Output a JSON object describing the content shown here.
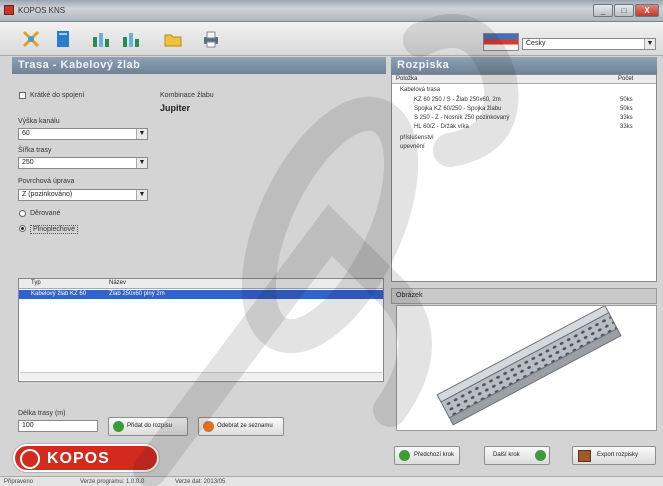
{
  "window": {
    "title": "KOPOS KNS",
    "minimize": "_",
    "maximize": "□",
    "close": "X"
  },
  "toolbar": {
    "tools": [
      "new-icon",
      "book-icon",
      "bar-chart-icon",
      "bar-chart-icon",
      "folder-icon",
      "printer-icon"
    ],
    "language": {
      "value": "Česky",
      "arrow": "▼"
    }
  },
  "left": {
    "section_title": "Trasa - Kabelový žlab",
    "chk_label": "Krátké do spojení",
    "product_caption": "Kombinace žlabu",
    "product_name": "Jupiter",
    "fields": [
      {
        "label": "Výška kanálu",
        "value": "60"
      },
      {
        "label": "Šířka trasy",
        "value": "250"
      },
      {
        "label": "Povrchová úprava",
        "value": "Z (pozinkováno)"
      }
    ],
    "radios": [
      {
        "label": "Děrované",
        "on": false
      },
      {
        "label": "Plnoplechové",
        "on": true
      }
    ],
    "grid": {
      "headers": [
        "Typ",
        "Název"
      ],
      "row": [
        "Kabelový žlab KZ 60",
        "Žlab 250x60 plný 2m"
      ]
    },
    "length_label": "Délka trasy (m)",
    "length_value": "100",
    "buttons": [
      "Přidat do rozpisu",
      "Odebrat ze seznamu"
    ]
  },
  "right": {
    "section_title": "Rozpiska",
    "headers": [
      "Položka",
      "Počet"
    ],
    "tree": [
      {
        "text": "Kabelová trasa",
        "qty": ""
      },
      {
        "text": "KZ 60 250 / S - Žlab 250x60, 2m",
        "qty": "50ks"
      },
      {
        "text": "Spojka KZ 60/250 - Spojka žlabu",
        "qty": "50ks"
      },
      {
        "text": "S 250 - Z - Nosník 250 pozinkovaný",
        "qty": "33ks"
      },
      {
        "text": "HL 60/Z - Držák víka",
        "qty": "33ks"
      },
      {
        "text": "příslušenství",
        "qty": ""
      },
      {
        "text": "upevnění",
        "qty": ""
      }
    ],
    "image_title": "Obrázek",
    "buttons": [
      "Předchozí krok",
      "Další krok",
      "Export rozpisky"
    ]
  },
  "logo": "KOPOS",
  "status": [
    "Připraveno",
    "Verze programu: 1.0.0.0",
    "Verze dat: 2013/05"
  ],
  "watermark": "ROS",
  "colors": {
    "brand_red": "#d22a1f",
    "header_blue": "#7a8da1",
    "selection": "#2f64c8"
  }
}
